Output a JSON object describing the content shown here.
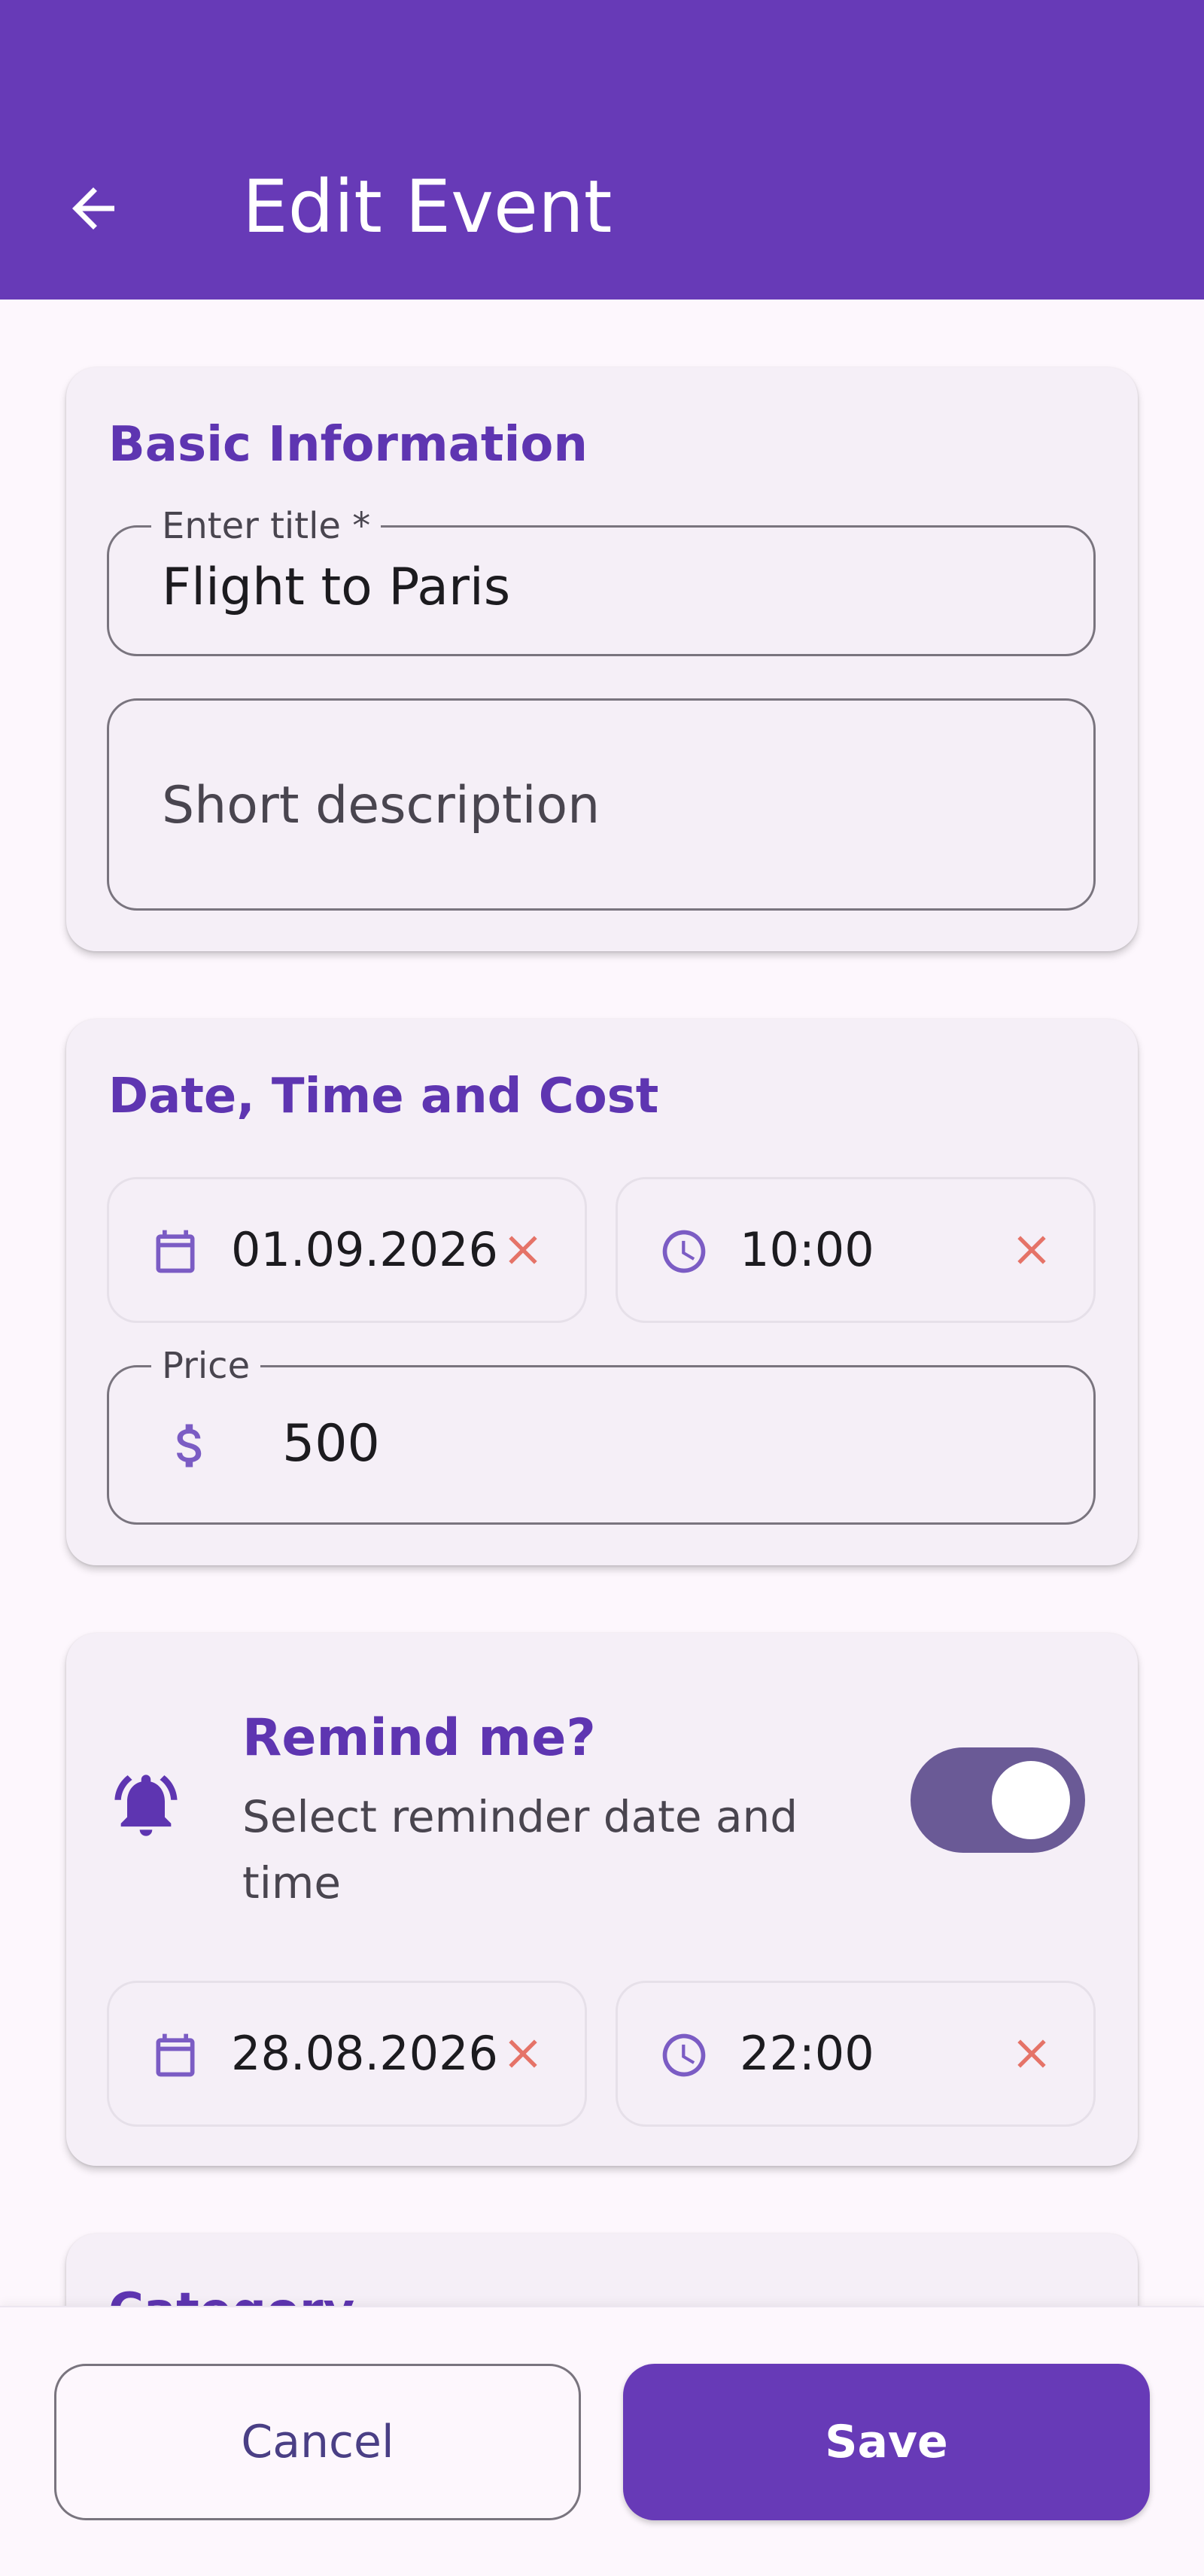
{
  "app_bar": {
    "title": "Edit Event",
    "back_icon": "arrow-back-icon",
    "background": "#673AB7"
  },
  "basic_info": {
    "title": "Basic Information",
    "title_field": {
      "label": "Enter title *",
      "value": "Flight to Paris"
    },
    "description_field": {
      "placeholder": "Short description",
      "value": ""
    }
  },
  "date_time_cost": {
    "title": "Date, Time and Cost",
    "date": {
      "value": "01.09.2026",
      "icon": "calendar-icon",
      "clear_icon": "close-icon"
    },
    "time": {
      "value": "10:00",
      "icon": "clock-icon",
      "clear_icon": "close-icon"
    },
    "price": {
      "label": "Price",
      "value": "500",
      "icon": "dollar-icon"
    }
  },
  "reminder": {
    "title": "Remind me?",
    "subtitle": "Select reminder date and time",
    "icon": "bell-ringing-icon",
    "enabled": true,
    "date": {
      "value": "28.08.2026",
      "icon": "calendar-icon",
      "clear_icon": "close-icon"
    },
    "time": {
      "value": "22:00",
      "icon": "clock-icon",
      "clear_icon": "close-icon"
    }
  },
  "category": {
    "title": "Category"
  },
  "actions": {
    "cancel_label": "Cancel",
    "save_label": "Save"
  },
  "colors": {
    "primary": "#673AB7",
    "accent_text": "#5E35B1",
    "clear": "#E57368",
    "icon": "#7B5CC4"
  }
}
